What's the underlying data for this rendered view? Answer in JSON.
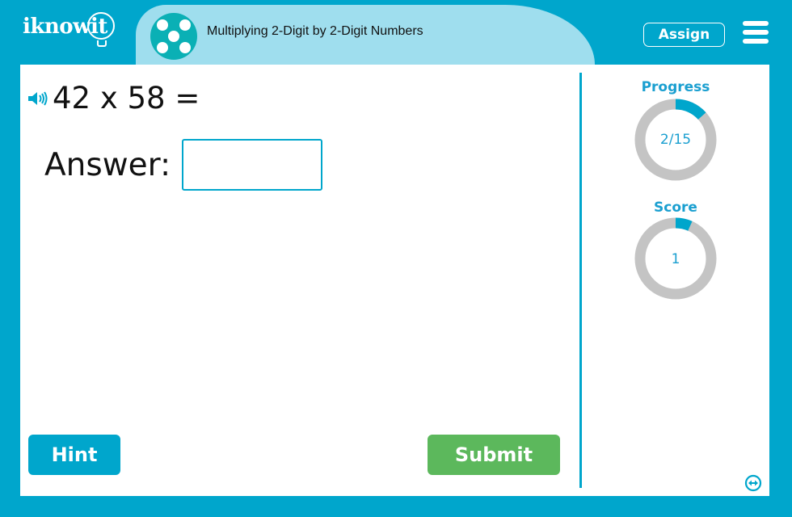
{
  "header": {
    "logo_text": "iknowit",
    "lesson_icon": "dice-five-icon",
    "title": "Multiplying 2-Digit by 2-Digit Numbers",
    "assign_label": "Assign",
    "menu_icon": "hamburger-menu-icon"
  },
  "question": {
    "speaker_icon": "speaker-icon",
    "text": "42 x 58 ="
  },
  "answer": {
    "label": "Answer:",
    "value": "",
    "placeholder": ""
  },
  "buttons": {
    "hint_label": "Hint",
    "submit_label": "Submit"
  },
  "sidebar": {
    "progress": {
      "label": "Progress",
      "value_text": "2/15",
      "current": 2,
      "total": 15
    },
    "score": {
      "label": "Score",
      "value_text": "1",
      "current": 1,
      "total": 15
    },
    "expand_icon": "expand-horizontal-icon"
  },
  "colors": {
    "frame": "#00a6cc",
    "title_pill": "#9fdeee",
    "lesson_icon_bg": "#0ab0b5",
    "ring_track": "#c4c4c4",
    "ring_fill": "#00a6cc",
    "stat_text": "#1a9fd0",
    "submit": "#5cb85c",
    "hint": "#00a6cc"
  }
}
